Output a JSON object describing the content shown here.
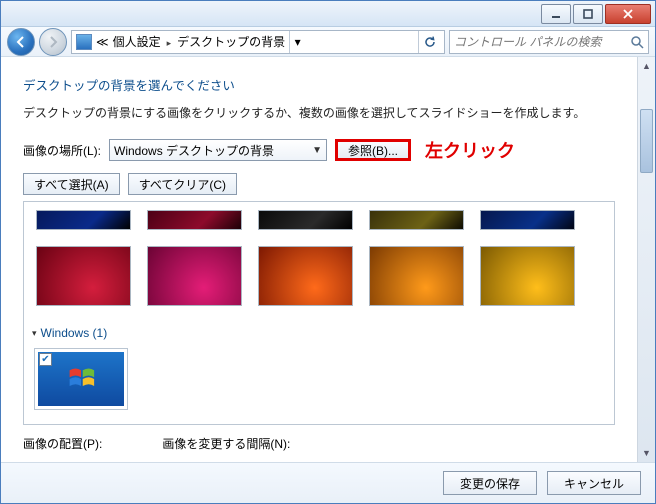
{
  "titlebar": {},
  "navbar": {
    "breadcrumb": [
      "個人設定",
      "デスクトップの背景"
    ],
    "prefix": "≪",
    "search_placeholder": "コントロール パネルの検索"
  },
  "content": {
    "heading": "デスクトップの背景を選んでください",
    "desc": "デスクトップの背景にする画像をクリックするか、複数の画像を選択してスライドショーを作成します。",
    "location_label": "画像の場所(L):",
    "dropdown_value": "Windows デスクトップの背景",
    "browse_label": "参照(B)...",
    "annotation": "左クリック",
    "select_all": "すべて選択(A)",
    "clear_all": "すべてクリア(C)",
    "section_windows": "Windows (1)",
    "position_label": "画像の配置(P):",
    "interval_label": "画像を変更する間隔(N):"
  },
  "footer": {
    "save": "変更の保存",
    "cancel": "キャンセル"
  }
}
